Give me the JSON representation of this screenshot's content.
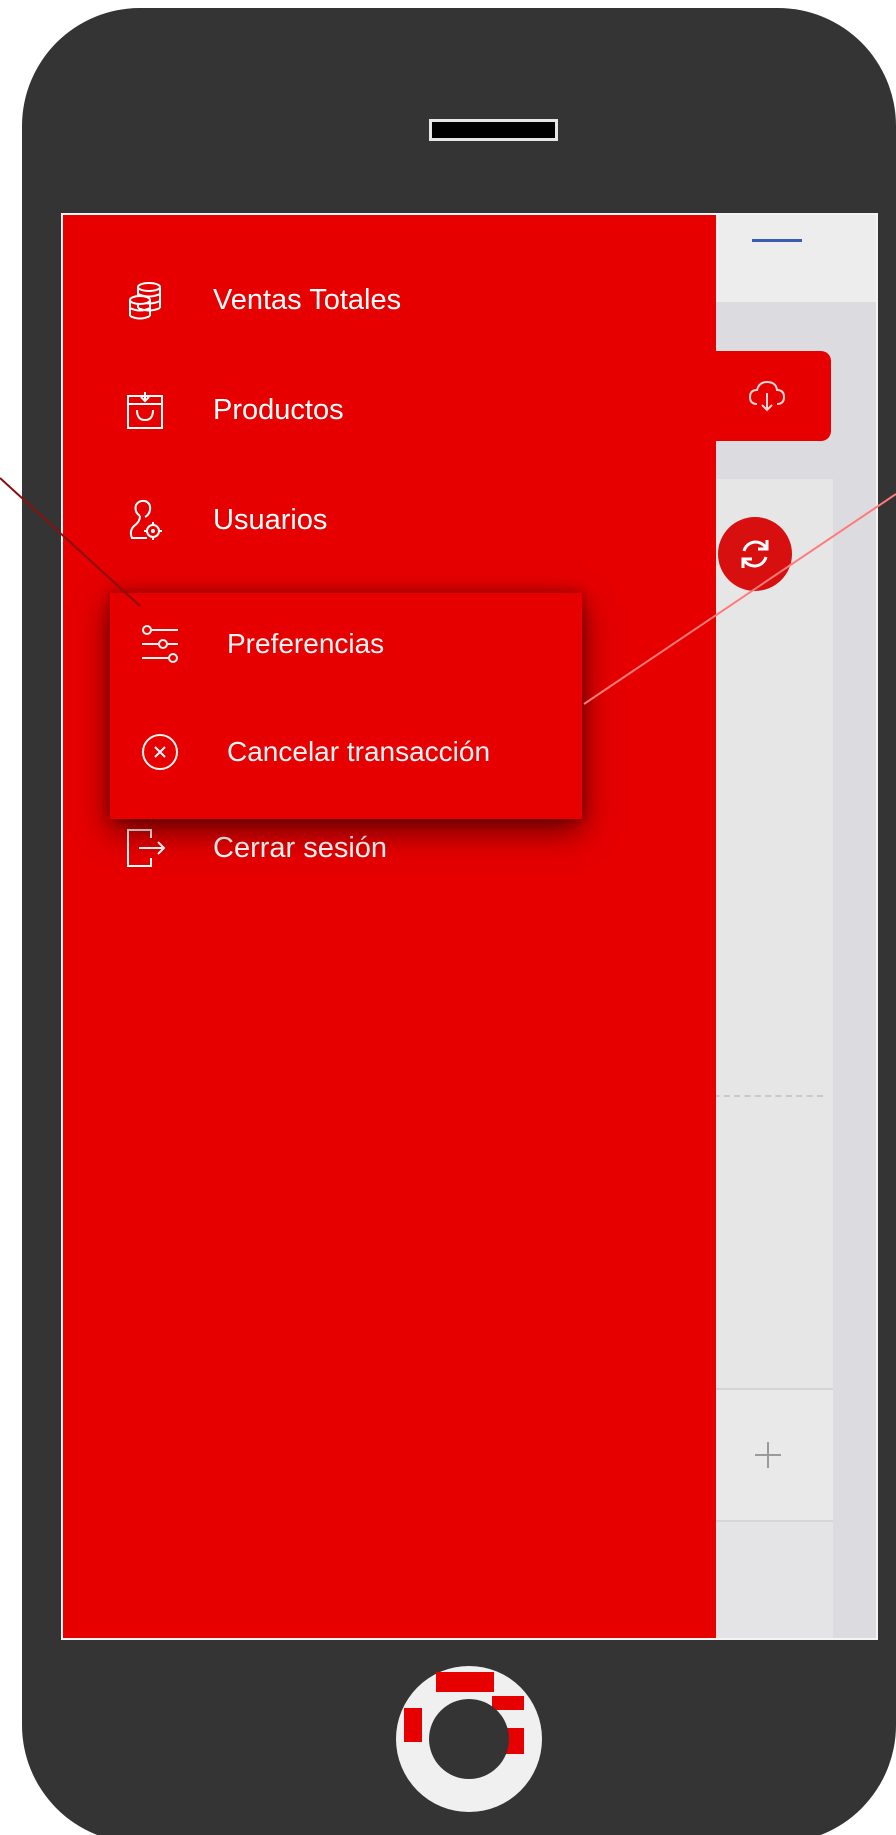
{
  "drawer": {
    "items": [
      {
        "label": "Ventas Totales",
        "icon": "coins-icon"
      },
      {
        "label": "Productos",
        "icon": "shopping-bag-icon"
      },
      {
        "label": "Usuarios",
        "icon": "user-settings-icon"
      },
      {
        "label": "Cerrar sesión",
        "icon": "logout-icon"
      }
    ]
  },
  "popup": {
    "items": [
      {
        "label": "Preferencias",
        "icon": "sliders-icon"
      },
      {
        "label": "Cancelar transacción",
        "icon": "cancel-circle-icon"
      }
    ]
  },
  "background_app": {
    "icons": [
      "menu-icon",
      "cloud-download-icon",
      "sync-icon",
      "plus-icon"
    ]
  },
  "colors": {
    "brand_red": "#e60000",
    "phone_body": "#343434",
    "screen_bg": "#ececec"
  }
}
